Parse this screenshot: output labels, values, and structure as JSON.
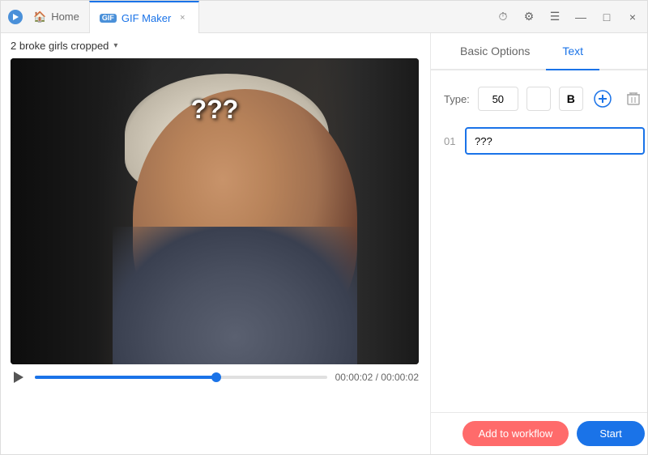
{
  "titlebar": {
    "home_label": "Home",
    "tab_label": "GIF Maker",
    "tab_close": "×"
  },
  "file_selector": {
    "label": "2 broke girls cropped",
    "arrow": "▾"
  },
  "video": {
    "text_overlay": "???",
    "time_current": "00:00:02",
    "time_total": "00:00:02",
    "time_display": "00:00:02 / 00:00:02",
    "progress_percent": 62
  },
  "right_panel": {
    "tab_basic": "Basic Options",
    "tab_text": "Text",
    "type_label": "Type:",
    "font_size": "50",
    "bold_label": "B",
    "text_row_num": "01",
    "text_input_value": "???",
    "text_input_placeholder": "???"
  },
  "bottom_bar": {
    "workflow_label": "Add to workflow",
    "start_label": "Start"
  },
  "icons": {
    "timer": "⏱",
    "settings": "⚙",
    "menu": "☰",
    "minimize": "—",
    "maximize": "□",
    "close": "×",
    "add": "⊕",
    "delete": "🗑",
    "play": "▶"
  }
}
